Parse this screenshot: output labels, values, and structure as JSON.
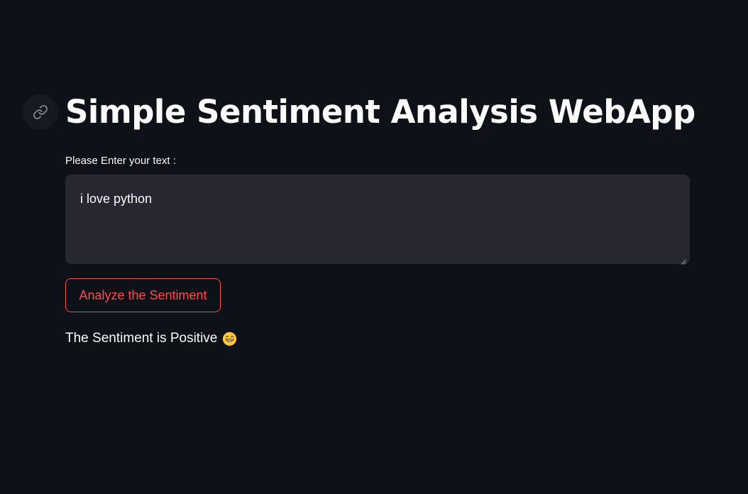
{
  "header": {
    "title": "Simple Sentiment Analysis WebApp",
    "anchor_icon": "link-icon"
  },
  "form": {
    "text_label": "Please Enter your text :",
    "text_value": "i love python",
    "analyze_label": "Analyze the Sentiment"
  },
  "result": {
    "text": "The Sentiment is Positive",
    "emoji_icon": "grinning-face-emoji-icon"
  },
  "colors": {
    "background": "#0e1117",
    "input_background": "#262730",
    "accent": "#ff4b4b",
    "text": "#fafafa"
  }
}
